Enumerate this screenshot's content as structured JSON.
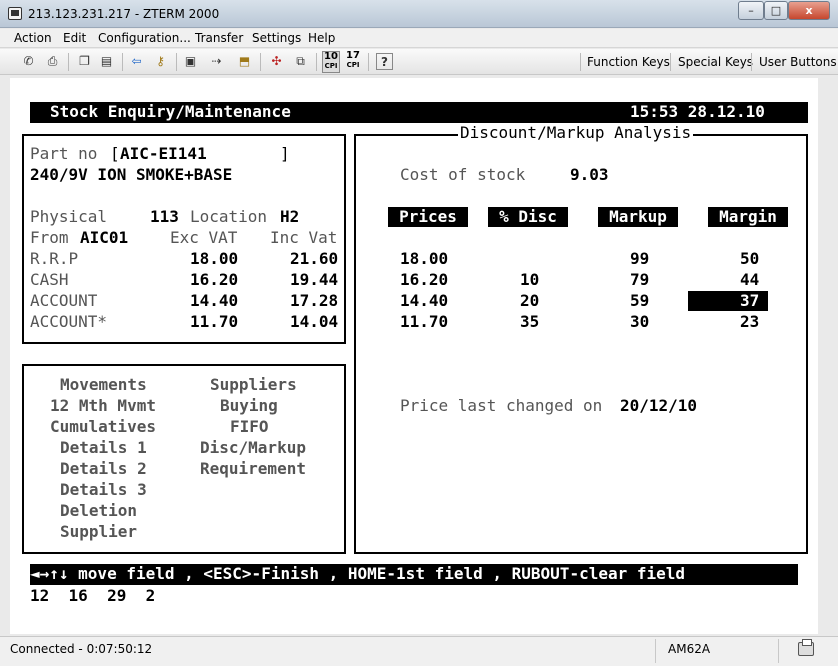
{
  "window": {
    "title": "213.123.231.217 - ZTERM 2000",
    "minimize": "–",
    "maximize": "□",
    "close": "x"
  },
  "menu": [
    "Action",
    "Edit",
    "Configuration...",
    "Transfer",
    "Settings",
    "Help"
  ],
  "toolbar": {
    "icons": [
      "connect-icon",
      "print-icon",
      "copy-icon",
      "paste-icon",
      "back-arrow-icon",
      "key-icon",
      "capture-icon",
      "send-icon",
      "receive-icon",
      "macro-icon",
      "window-icon"
    ],
    "cpi10": {
      "num": "10",
      "sub": "CPI"
    },
    "cpi17": {
      "num": "17",
      "sub": "CPI"
    },
    "help": "?",
    "function_keys": "Function Keys",
    "special_keys": "Special Keys",
    "user_buttons": "User Buttons"
  },
  "terminal": {
    "title": "Stock Enquiry/Maintenance",
    "clock": "15:53 28.12.10",
    "part": {
      "label": "Part no",
      "open": "[",
      "value": "AIC-EI141",
      "close": "]"
    },
    "description": "240/9V ION SMOKE+BASE",
    "physical": {
      "label": "Physical",
      "value": "113",
      "location_label": "Location",
      "location": "H2"
    },
    "from": {
      "label": "From",
      "value": "AIC01",
      "exc_vat": "Exc VAT",
      "inc_vat": "Inc Vat"
    },
    "price_rows": [
      {
        "label": "R.R.P",
        "exc": "18.00",
        "inc": "21.60"
      },
      {
        "label": "CASH",
        "exc": "16.20",
        "inc": "19.44"
      },
      {
        "label": "ACCOUNT",
        "exc": "14.40",
        "inc": "17.28"
      },
      {
        "label": "ACCOUNT*",
        "exc": "11.70",
        "inc": "14.04"
      }
    ],
    "menu_left": [
      "Movements",
      "12 Mth Mvmt",
      "Cumulatives",
      "Details 1",
      "Details 2",
      "Details 3",
      "Deletion",
      "Supplier"
    ],
    "menu_right": [
      "Suppliers",
      "Buying",
      "FIFO",
      "Disc/Markup",
      "Requirement"
    ],
    "analysis": {
      "title": "Discount/Markup Analysis",
      "cost_label": "Cost of stock",
      "cost": "9.03",
      "headers": [
        "Prices",
        "% Disc",
        "Markup",
        "Margin"
      ],
      "rows": [
        {
          "price": "18.00",
          "disc": "",
          "markup": "99",
          "margin": "50"
        },
        {
          "price": "16.20",
          "disc": "10",
          "markup": "79",
          "margin": "44"
        },
        {
          "price": "14.40",
          "disc": "20",
          "markup": "59",
          "margin": "37"
        },
        {
          "price": "11.70",
          "disc": "35",
          "markup": "30",
          "margin": "23"
        }
      ],
      "last_changed_label": "Price last changed on",
      "last_changed": "20/12/10"
    },
    "help_line": "◄→↑↓ move field , <ESC>-Finish , HOME-1st field , RUBOUT-clear field",
    "bottom_line": "12  16  29  2"
  },
  "status": {
    "connected": "Connected - 0:07:50:12",
    "terminal_type": "AM62A"
  }
}
